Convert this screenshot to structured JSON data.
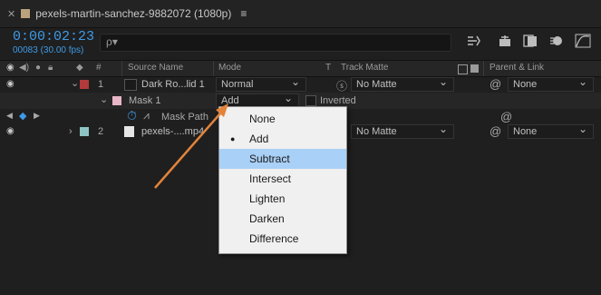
{
  "tab": {
    "title": "pexels-martin-sanchez-9882072 (1080p)",
    "menu_glyph": "≡",
    "close_glyph": "✕"
  },
  "header": {
    "timecode": "0:00:02:23",
    "frames": "00083 (30.00 fps)",
    "search_placeholder": "ρ▾"
  },
  "columns": {
    "hash": "#",
    "source_name": "Source Name",
    "mode": "Mode",
    "t": "T",
    "track_matte": "Track Matte",
    "parent_link": "Parent & Link"
  },
  "layers": [
    {
      "num": "1",
      "name": "Dark Ro...lid 1",
      "mode": "Normal",
      "matte": "No Matte",
      "parent": "None",
      "label_color": "#b23a3a"
    },
    {
      "num": "2",
      "name": "pexels-....mp4",
      "matte": "No Matte",
      "parent": "None",
      "label_color": "#8ec4c4"
    }
  ],
  "mask": {
    "name": "Mask 1",
    "mode": "Add",
    "inverted": "Inverted",
    "path_label": "Mask Path",
    "label_color": "#e8b6c6"
  },
  "menu": {
    "items": [
      "None",
      "Add",
      "Subtract",
      "Intersect",
      "Lighten",
      "Darken",
      "Difference"
    ],
    "checked": "Add",
    "highlighted": "Subtract"
  },
  "colors": {
    "accent": "#3e9ae6",
    "arrow": "#e3833a",
    "menu_highlight": "#a9d0f6"
  }
}
